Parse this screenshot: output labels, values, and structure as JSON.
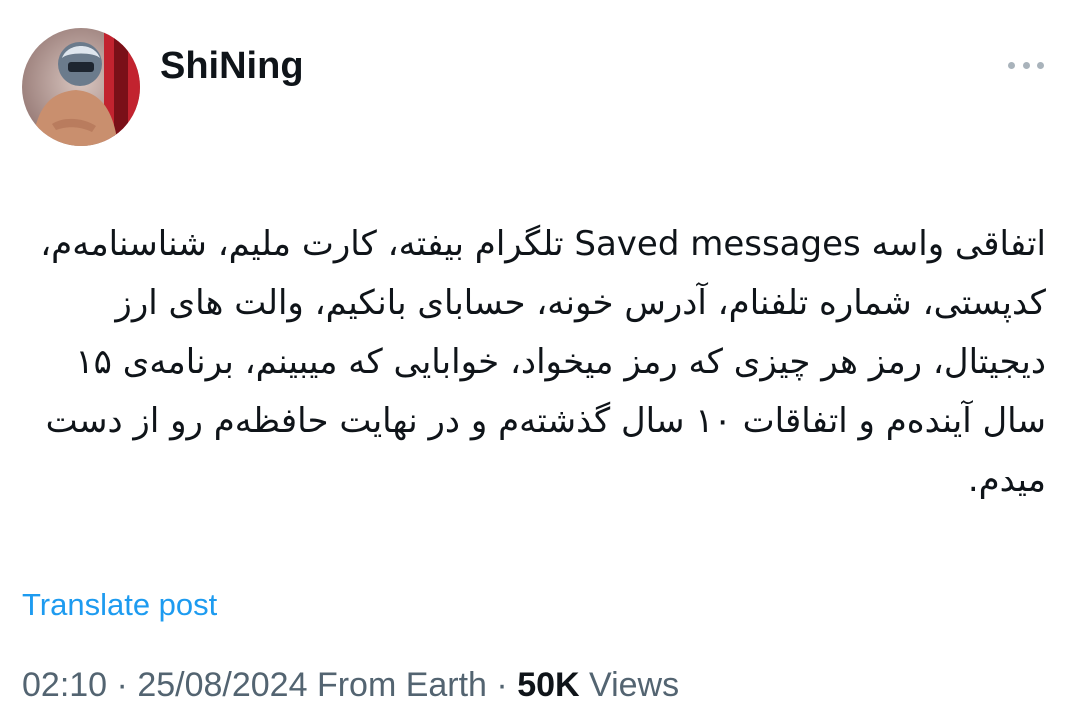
{
  "author": {
    "display_name": "ShiNing"
  },
  "post": {
    "text": "اتفاقی واسه Saved messages تلگرام بیفته، کارت ملیم، شناسنامه‌م، کدپستی، شماره تلفنام، آدرس خونه، حسابای بانکیم، والت های ارز دیجیتال، رمز هر چیزی که رمز میخواد، خوابایی که میبینم، برنامه‌ی ۱۵ سال آینده‌م و اتفاقات ۱۰ سال گذشته‌م و در نهایت حافظه‌م رو از دست میدم."
  },
  "actions": {
    "translate_label": "Translate post",
    "more_icon": "more-horizontal-icon"
  },
  "meta": {
    "time": "02:10",
    "separator": " · ",
    "date": "25/08/2024",
    "source": "From Earth",
    "views_count": "50K",
    "views_label": "Views"
  },
  "colors": {
    "link": "#1d9bf0",
    "text": "#0f1419",
    "secondary": "#536471"
  }
}
